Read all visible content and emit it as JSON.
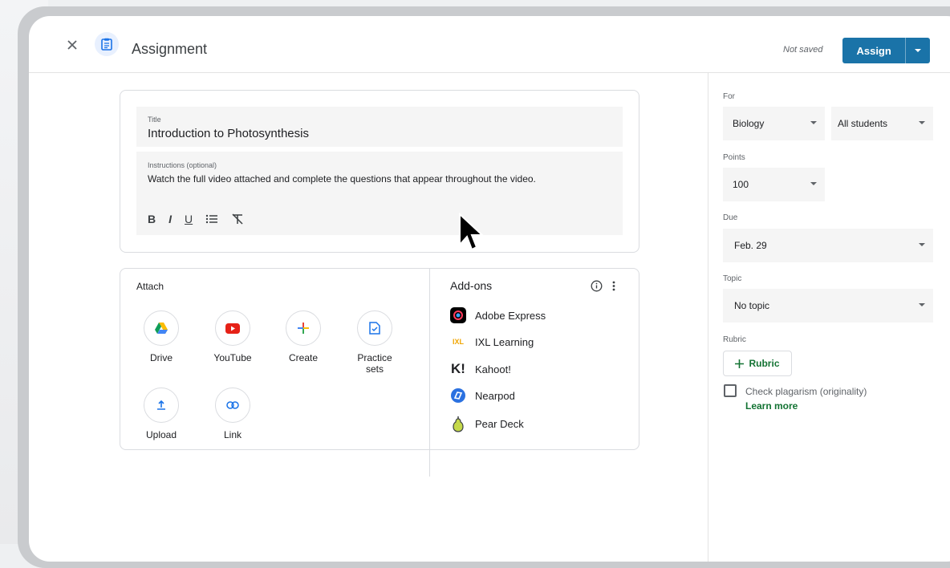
{
  "header": {
    "title": "Assignment",
    "status": "Not saved",
    "assign_label": "Assign"
  },
  "form": {
    "title_label": "Title",
    "title_value": "Introduction to Photosynthesis",
    "instructions_label": "Instructions (optional)",
    "instructions_value": "Watch the full video attached and complete the questions that appear throughout the video.",
    "format_buttons": [
      "B",
      "I",
      "U",
      "list",
      "clear-format"
    ]
  },
  "attach": {
    "heading": "Attach",
    "items": [
      {
        "label": "Drive",
        "icon": "drive-icon"
      },
      {
        "label": "YouTube",
        "icon": "youtube-icon"
      },
      {
        "label": "Create",
        "icon": "plus-icon"
      },
      {
        "label": "Practice sets",
        "icon": "practice-sets-icon"
      },
      {
        "label": "Upload",
        "icon": "upload-icon"
      },
      {
        "label": "Link",
        "icon": "link-icon"
      }
    ]
  },
  "addons": {
    "heading": "Add-ons",
    "items": [
      {
        "label": "Adobe Express",
        "icon": "adobe-express-icon"
      },
      {
        "label": "IXL Learning",
        "icon": "ixl-icon"
      },
      {
        "label": "Kahoot!",
        "icon": "kahoot-icon"
      },
      {
        "label": "Nearpod",
        "icon": "nearpod-icon"
      },
      {
        "label": "Pear Deck",
        "icon": "pear-deck-icon"
      }
    ]
  },
  "sidebar": {
    "for_label": "For",
    "class_value": "Biology",
    "students_value": "All students",
    "points_label": "Points",
    "points_value": "100",
    "due_label": "Due",
    "due_value": "Feb. 29",
    "topic_label": "Topic",
    "topic_value": "No topic",
    "rubric_label": "Rubric",
    "rubric_button": "Rubric",
    "plagiarism_label": "Check plagarism (originality)",
    "learn_more": "Learn more"
  },
  "colors": {
    "assign_button": "#1a73a8",
    "accent_green": "#137333"
  }
}
